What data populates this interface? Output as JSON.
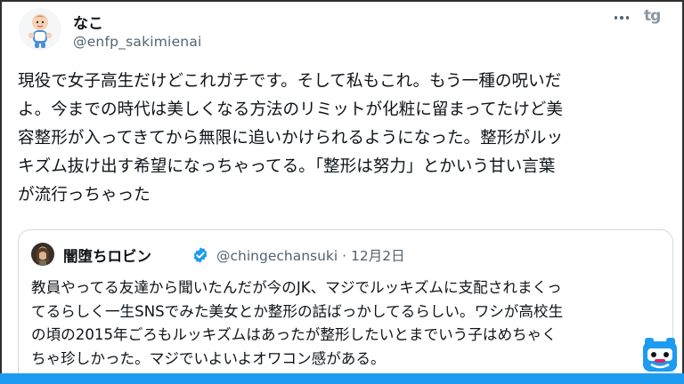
{
  "author": {
    "name": "なこ",
    "handle": "@enfp_sakimienai"
  },
  "header": {
    "more_icon": "more-horizontal-icon",
    "logo_text": "tg"
  },
  "tweet": {
    "text": "現役で女子高生だけどこれガチです。そして私もこれ。もう一種の呪いだ\nよ。今までの時代は美しくなる方法のリミットが化粧に留まってたけど美\n容整形が入ってきてから無限に追いかけられるようになった。整形がルッ\nキズム抜け出す希望になっちゃってる。「整形は努力」とかいう甘い言葉\nが流行っちゃった"
  },
  "quote": {
    "name": "闇堕ちロビン",
    "verified_icon": "verified-badge-icon",
    "handle_date": "@chingechansuki · 12月2日",
    "text": "教員やってる友達から聞いたんだが今のJK、マジでルッキズムに支配されまくっ\nてるらしく一生SNSでみた美女とか整形の話ばっかしてるらしい。ワシが高校生\nの頃の2015年ごろもルッキズムはあったが整形したいとまでいう子はめちゃく\nちゃ珍しかった。マジでいよいよオワコン感がある。"
  },
  "colors": {
    "accent": "#1d9bf0",
    "text": "#0f1419",
    "muted": "#536471",
    "border": "#cfd9de"
  }
}
